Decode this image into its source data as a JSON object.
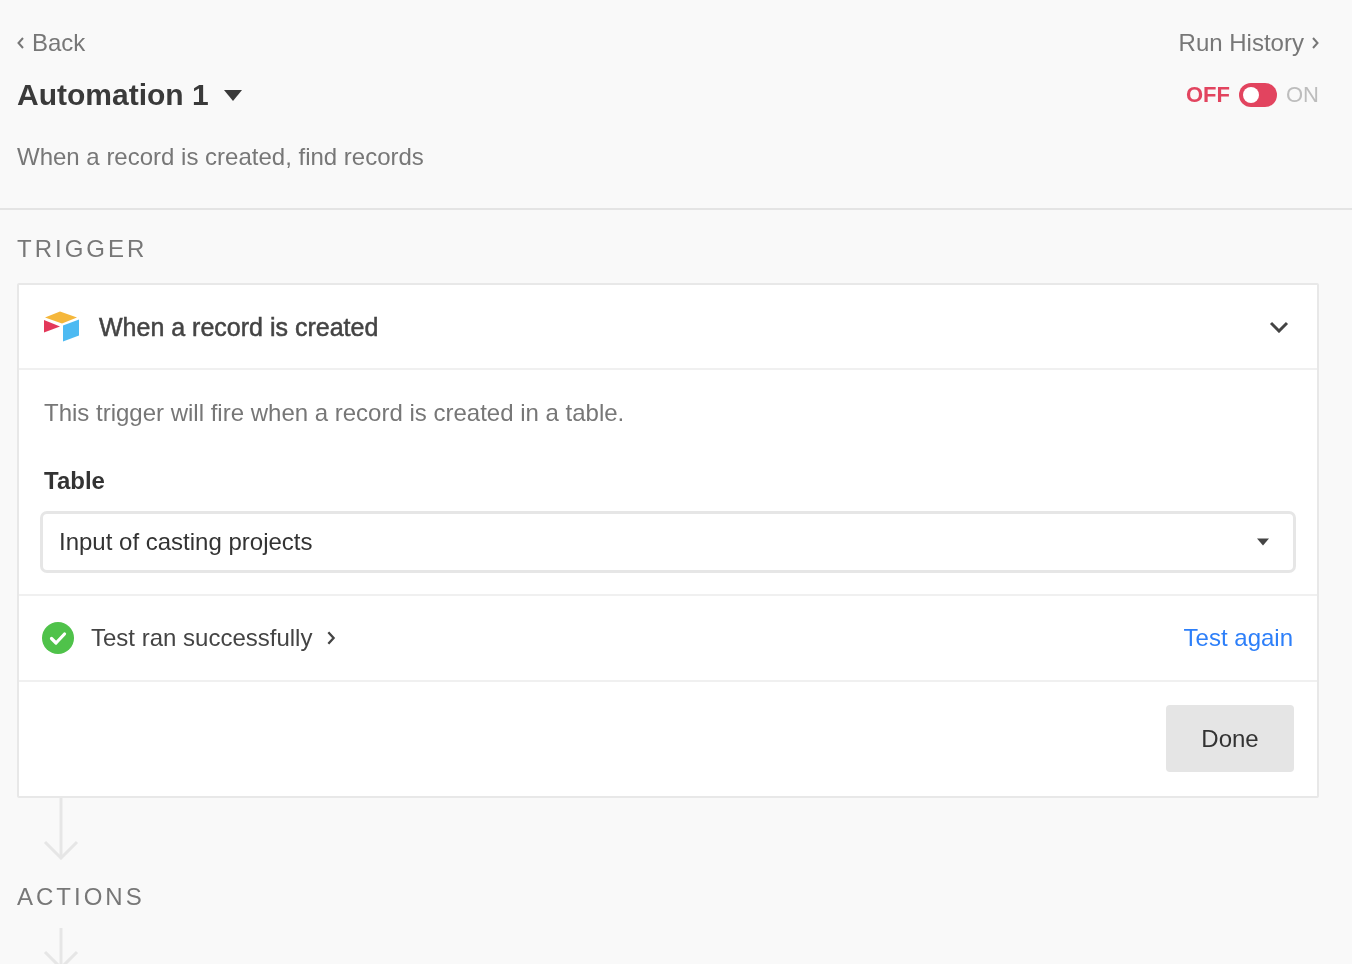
{
  "nav": {
    "back": "Back",
    "run_history": "Run History"
  },
  "automation": {
    "name": "Automation 1",
    "description": "When a record is created, find records",
    "toggle": {
      "off_label": "OFF",
      "on_label": "ON",
      "on": false
    }
  },
  "trigger": {
    "heading": "TRIGGER",
    "title": "When a record is created",
    "expanded": true,
    "description": "This trigger will fire when a record is created in a table.",
    "table_label": "Table",
    "table_value": "Input of casting projects",
    "test": {
      "status": "Test ran successfully",
      "success": true,
      "action": "Test again"
    },
    "done": "Done"
  },
  "actions": {
    "heading": "ACTIONS"
  }
}
